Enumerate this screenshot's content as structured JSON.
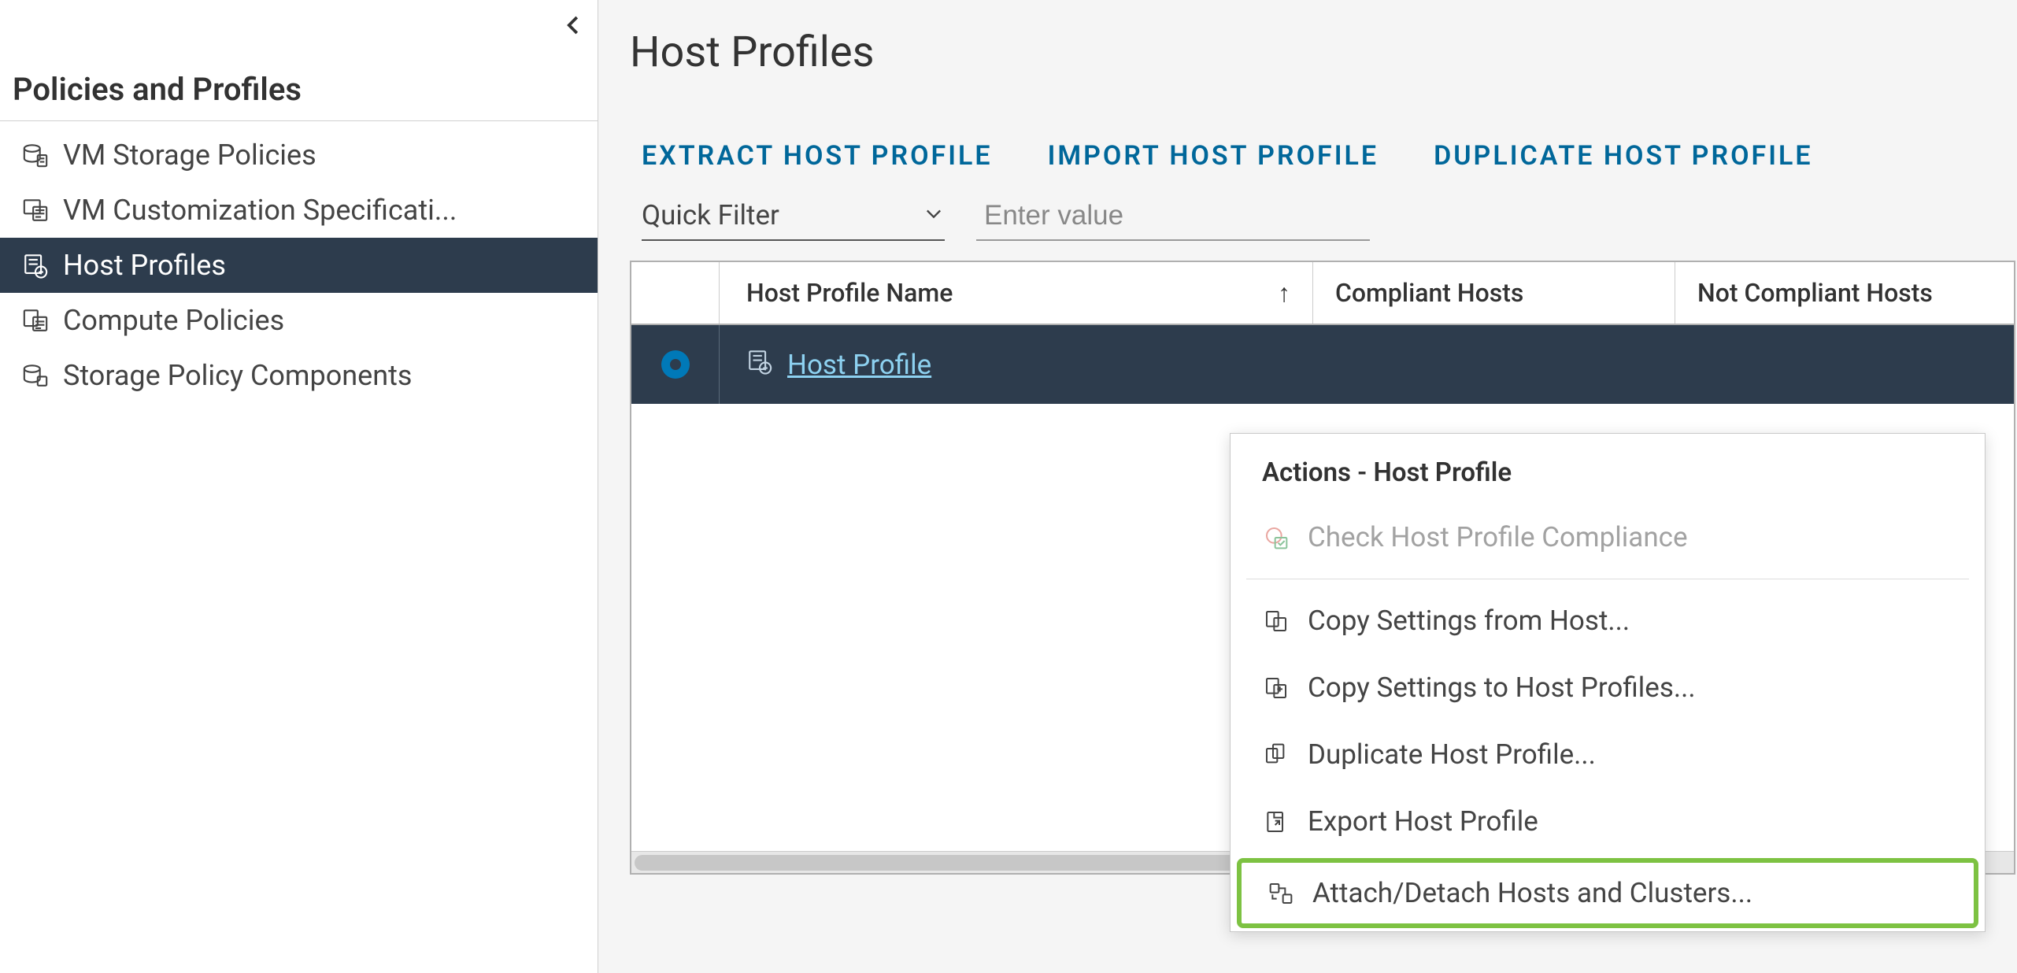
{
  "sidebar": {
    "title": "Policies and Profiles",
    "items": [
      {
        "label": "VM Storage Policies"
      },
      {
        "label": "VM Customization Specificati..."
      },
      {
        "label": "Host Profiles"
      },
      {
        "label": "Compute Policies"
      },
      {
        "label": "Storage Policy Components"
      }
    ]
  },
  "main": {
    "title": "Host Profiles",
    "actions": {
      "extract": "EXTRACT HOST PROFILE",
      "import": "IMPORT HOST PROFILE",
      "duplicate": "DUPLICATE HOST PROFILE"
    },
    "filter": {
      "quick_label": "Quick Filter",
      "placeholder": "Enter value"
    },
    "table": {
      "col_name": "Host Profile Name",
      "col_compliant": "Compliant Hosts",
      "col_notcompliant": "Not Compliant Hosts",
      "row_link": "Host Profile"
    }
  },
  "context": {
    "title": "Actions - Host Profile",
    "check": "Check Host Profile Compliance",
    "copy_from": "Copy Settings from Host...",
    "copy_to": "Copy Settings to Host Profiles...",
    "duplicate": "Duplicate Host Profile...",
    "export": "Export Host Profile",
    "attach": "Attach/Detach Hosts and Clusters..."
  }
}
